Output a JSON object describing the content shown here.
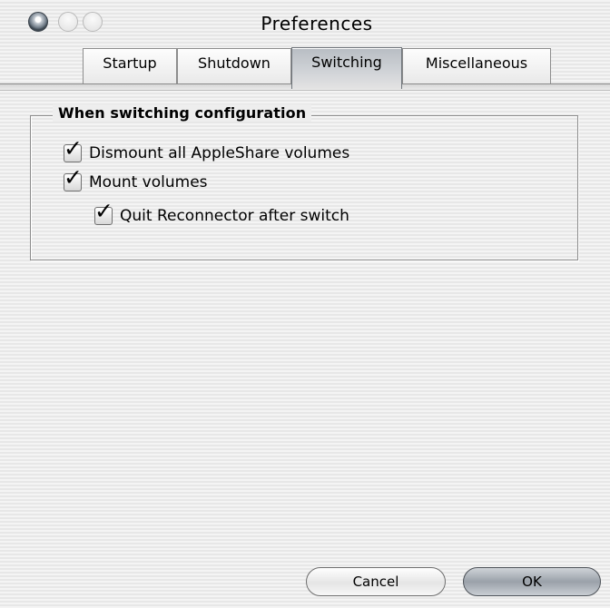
{
  "window": {
    "title": "Preferences"
  },
  "tabs": [
    {
      "label": "Startup"
    },
    {
      "label": "Shutdown"
    },
    {
      "label": "Switching",
      "selected": true
    },
    {
      "label": "Miscellaneous"
    }
  ],
  "group": {
    "title": "When switching configuration",
    "options": [
      {
        "label": "Dismount all AppleShare volumes",
        "checked": true
      },
      {
        "label": "Mount volumes",
        "checked": true
      },
      {
        "label": "Quit Reconnector after switch",
        "checked": true
      }
    ]
  },
  "buttons": {
    "cancel": "Cancel",
    "ok": "OK"
  },
  "icons": {
    "checkmark": "✓"
  }
}
